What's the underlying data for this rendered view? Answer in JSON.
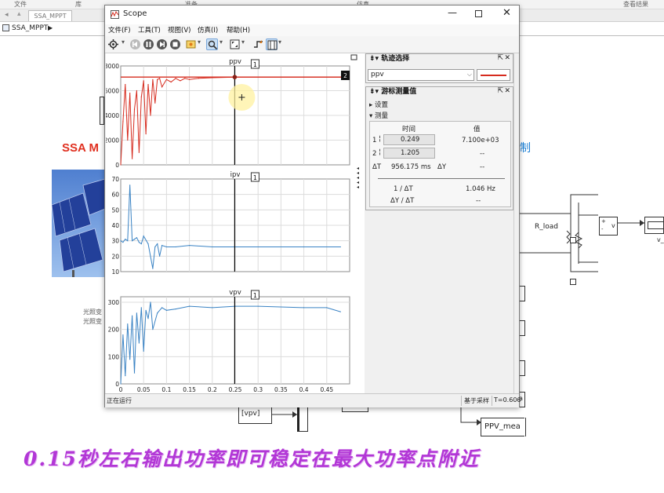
{
  "simulink": {
    "ribbon_labels": [
      "文件",
      "库",
      "准备",
      "仿真",
      "查看结果"
    ],
    "tab_label": "SSA_MPPT",
    "breadcrumb": "SSA_MPPT",
    "title_fragment": "SSA M",
    "title_fragment_right": "制",
    "annot_line1": "光照变",
    "annot_line2": "光照变",
    "r_load_label": "R_load",
    "meas_plus": "+",
    "meas_minus": "-",
    "meas_v": "v",
    "vout_label": "v_",
    "goto_vpv": "[vpv]",
    "goto_ppv_mea": "PPV_mea",
    "goto_fragment": "a"
  },
  "scope": {
    "window_title": "Scope",
    "menus": [
      "文件(F)",
      "工具(T)",
      "视图(V)",
      "仿真(I)",
      "帮助(H)"
    ],
    "toolbar_icons": [
      "gear-icon",
      "step-back-icon",
      "run-icon",
      "step-forward-icon",
      "stop-icon",
      "highlight-icon",
      "zoom-icon",
      "autoscale-icon",
      "triggers-icon",
      "cursor-measurements-icon"
    ],
    "status_left": "正在运行",
    "status_mid": "基于采样",
    "status_right": "T=0.606",
    "cursor_label_1": "1",
    "cursor_label_2": "2",
    "trace_panel": {
      "title": "轨迹选择",
      "selected_signal": "ppv",
      "line_color": "#d62b1e"
    },
    "cursor_panel": {
      "title": "游标测量值",
      "settings_label": "设置",
      "measure_label": "测量",
      "col_time": "时间",
      "col_value": "值",
      "row1_index": "1",
      "row1_time": "0.249",
      "row1_value": "7.100e+03",
      "row2_index": "2",
      "row2_time": "1.205",
      "row2_value": "--",
      "delta_t_label": "ΔT",
      "delta_t_value": "956.175 ms",
      "delta_y_label": "ΔY",
      "delta_y_value": "--",
      "inv_dt_label": "1 / ΔT",
      "inv_dt_value": "1.046 Hz",
      "dy_dt_label": "ΔY / ΔT",
      "dy_dt_value": "--"
    }
  },
  "chart_data": [
    {
      "type": "line",
      "title": "ppv",
      "color": "#d62b1e",
      "xlim": [
        0,
        0.5
      ],
      "ylim": [
        0,
        8000
      ],
      "yticks": [
        0,
        2000,
        4000,
        6000,
        8000
      ],
      "grid": true,
      "x": [
        0,
        0.005,
        0.01,
        0.015,
        0.02,
        0.025,
        0.03,
        0.035,
        0.04,
        0.045,
        0.05,
        0.055,
        0.06,
        0.065,
        0.07,
        0.075,
        0.08,
        0.085,
        0.09,
        0.1,
        0.11,
        0.12,
        0.13,
        0.14,
        0.15,
        0.17,
        0.2,
        0.25,
        0.3,
        0.4,
        0.48
      ],
      "values": [
        0,
        3500,
        6500,
        2000,
        5800,
        500,
        4500,
        6000,
        1000,
        5500,
        6800,
        2500,
        6500,
        4000,
        6900,
        5000,
        6900,
        7000,
        6300,
        6900,
        6700,
        7000,
        6800,
        7000,
        6900,
        7000,
        7050,
        7100,
        7100,
        7100,
        7100
      ]
    },
    {
      "type": "line",
      "title": "ipv",
      "color": "#3a83c4",
      "xlim": [
        0,
        0.5
      ],
      "ylim": [
        10,
        70
      ],
      "yticks": [
        10,
        20,
        30,
        40,
        50,
        60,
        70
      ],
      "grid": true,
      "x": [
        0,
        0.005,
        0.01,
        0.015,
        0.02,
        0.025,
        0.03,
        0.035,
        0.04,
        0.045,
        0.05,
        0.06,
        0.07,
        0.075,
        0.08,
        0.085,
        0.09,
        0.1,
        0.12,
        0.15,
        0.2,
        0.25,
        0.3,
        0.4,
        0.48
      ],
      "values": [
        30,
        29,
        31,
        30,
        66,
        30,
        31,
        32,
        29,
        28,
        33,
        28,
        12,
        26,
        28,
        20,
        27,
        26,
        26,
        27,
        26,
        26,
        26,
        26,
        26
      ]
    },
    {
      "type": "line",
      "title": "vpv",
      "color": "#3a83c4",
      "xlim": [
        0,
        0.5
      ],
      "ylim": [
        0,
        320
      ],
      "yticks": [
        0,
        100,
        200,
        300
      ],
      "xticks": [
        0,
        0.05,
        0.1,
        0.15,
        0.2,
        0.25,
        0.3,
        0.35,
        0.4,
        0.45
      ],
      "grid": true,
      "x": [
        0,
        0.005,
        0.01,
        0.015,
        0.02,
        0.025,
        0.03,
        0.035,
        0.04,
        0.045,
        0.05,
        0.055,
        0.06,
        0.065,
        0.07,
        0.08,
        0.09,
        0.1,
        0.12,
        0.15,
        0.2,
        0.25,
        0.3,
        0.4,
        0.45,
        0.48
      ],
      "values": [
        0,
        180,
        30,
        220,
        90,
        250,
        40,
        260,
        150,
        280,
        120,
        270,
        240,
        300,
        200,
        260,
        280,
        270,
        275,
        285,
        280,
        285,
        285,
        280,
        280,
        265
      ]
    }
  ],
  "caption": "0.15秒左右输出功率即可稳定在最大功率点附近"
}
